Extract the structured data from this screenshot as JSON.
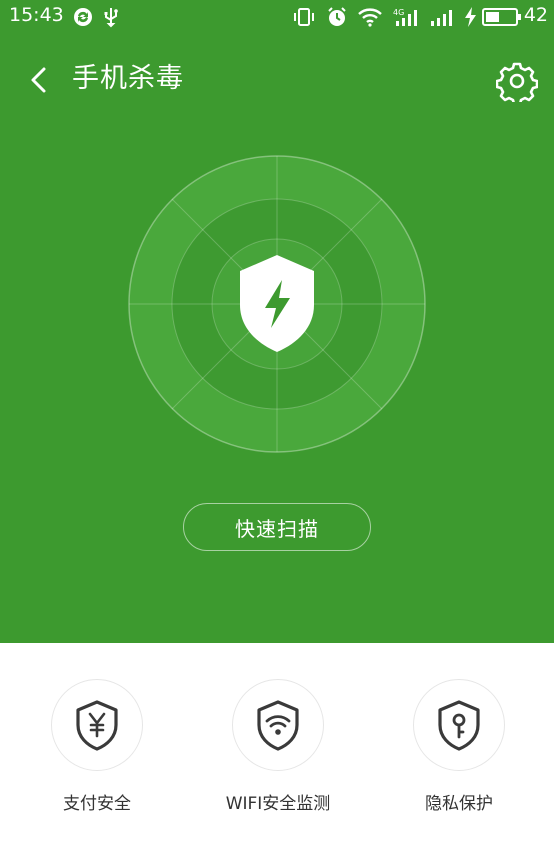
{
  "status_bar": {
    "time": "15:43",
    "network_label": "4G",
    "battery": "42"
  },
  "header": {
    "title": "手机杀毒",
    "back_icon": "chevron-left-icon",
    "settings_icon": "gear-icon"
  },
  "hero": {
    "shield_icon": "shield-bolt-icon",
    "scan_button_label": "快速扫描"
  },
  "features": [
    {
      "label": "支付安全",
      "icon": "shield-yen-icon"
    },
    {
      "label": "WIFI安全监测",
      "icon": "shield-wifi-icon"
    },
    {
      "label": "隐私保护",
      "icon": "shield-key-icon"
    }
  ],
  "colors": {
    "primary_green": "#3d9a2f",
    "icon_dark": "#3a3a3a"
  }
}
